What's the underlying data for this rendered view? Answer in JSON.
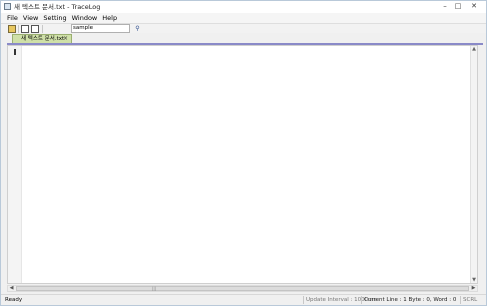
{
  "window": {
    "title": "새 텍스트 문서.txt - TraceLog",
    "minimize": "–",
    "maximize": "□",
    "close": "✕"
  },
  "menu": [
    "File",
    "View",
    "Setting",
    "Window",
    "Help"
  ],
  "toolbar": {
    "search_value": "sample",
    "find_icon": "find-binoculars-icon"
  },
  "tabs": [
    {
      "label": "새 텍스트 문서.txt",
      "close": "×",
      "active": true
    }
  ],
  "scroll": {
    "up": "▲",
    "down": "▼",
    "left": "◀",
    "right": "▶",
    "grip": "|||"
  },
  "status": {
    "ready": "Ready",
    "interval": "Update Interval : 1000ms",
    "current_line": "Current Line : 1 Byte : 0, Word : 0",
    "scrl": "SCRL"
  },
  "colors": {
    "tab_active": "#cfe0a8",
    "tab_underline": "#8a8ac8",
    "editor_bg": "#ffffff"
  }
}
